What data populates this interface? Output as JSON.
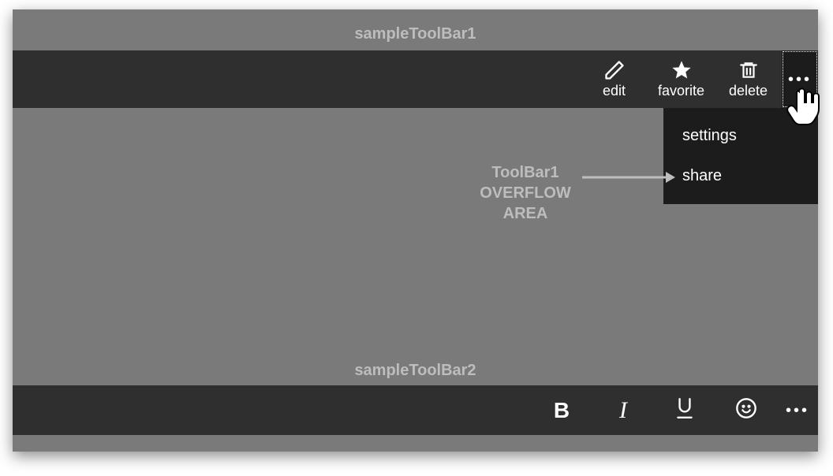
{
  "labels": {
    "toolbar1": "sampleToolBar1",
    "toolbar2": "sampleToolBar2"
  },
  "toolbar1": {
    "items": [
      {
        "icon": "pencil",
        "label": "edit"
      },
      {
        "icon": "star",
        "label": "favorite"
      },
      {
        "icon": "trash",
        "label": "delete"
      }
    ],
    "overflow": {
      "open": true,
      "items": [
        {
          "label": "settings"
        },
        {
          "label": "share"
        }
      ]
    }
  },
  "annotation": {
    "line1": "ToolBar1",
    "line2": "OVERFLOW",
    "line3": "AREA"
  },
  "toolbar2": {
    "items": [
      {
        "icon": "bold"
      },
      {
        "icon": "italic"
      },
      {
        "icon": "underline"
      },
      {
        "icon": "emoji"
      }
    ]
  }
}
